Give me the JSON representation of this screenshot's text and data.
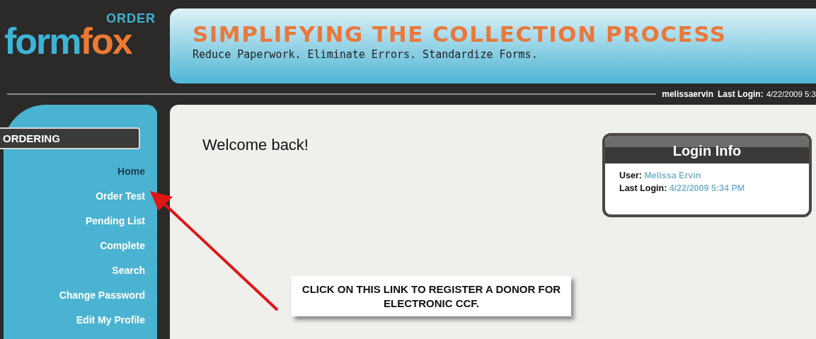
{
  "logo": {
    "word_1": "form",
    "word_2": "fox",
    "tag": "ORDER"
  },
  "banner": {
    "headline": "SIMPLIFYING THE COLLECTION PROCESS",
    "tagline": "Reduce Paperwork. Eliminate Errors. Standardize Forms."
  },
  "user_bar": {
    "username": "melissaervin",
    "last_login_label": "Last Login:",
    "last_login_value": "4/22/2009 5:3"
  },
  "sidebar": {
    "heading": "ORDERING",
    "items": [
      {
        "label": "Home",
        "selected": true
      },
      {
        "label": "Order Test",
        "selected": false
      },
      {
        "label": "Pending List",
        "selected": false
      },
      {
        "label": "Complete",
        "selected": false
      },
      {
        "label": "Search",
        "selected": false
      },
      {
        "label": "Change Password",
        "selected": false
      },
      {
        "label": "Edit My Profile",
        "selected": false
      }
    ]
  },
  "main": {
    "greeting": "Welcome back!"
  },
  "login_info": {
    "title": "Login Info",
    "rows": [
      {
        "label": "User:",
        "value": "Melissa Ervin"
      },
      {
        "label": "Last Login:",
        "value": "4/22/2009 5:34 PM"
      }
    ]
  },
  "callout": {
    "text": "CLICK ON THIS LINK TO REGISTER A DONOR FOR ELECTRONIC CCF."
  }
}
